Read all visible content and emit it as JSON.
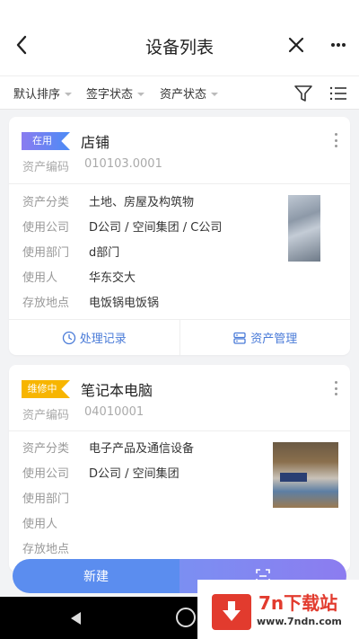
{
  "header": {
    "title": "设备列表"
  },
  "filters": [
    "默认排序",
    "签字状态",
    "资产状态"
  ],
  "labels": {
    "asset_code": "资产编码",
    "category": "资产分类",
    "company": "使用公司",
    "department": "使用部门",
    "user": "使用人",
    "location": "存放地点"
  },
  "cards": [
    {
      "badge": "在用",
      "name": "店铺",
      "asset_code": "010103.0001",
      "category": "土地、房屋及构筑物",
      "company": "D公司 / 空间集团 / C公司",
      "department": "d部门",
      "user": "华东交大",
      "location": "电饭锅电饭锅"
    },
    {
      "badge": "维修中",
      "name": "笔记本电脑",
      "asset_code": "04010001",
      "category": "电子产品及通信设备",
      "company": "D公司 / 空间集团",
      "department": "",
      "user": "",
      "location": ""
    }
  ],
  "actions": {
    "records": "处理记录",
    "manage": "资产管理"
  },
  "bottom": {
    "new_label": "新建"
  },
  "watermark": {
    "title": "7n下载站",
    "url": "www.7ndn.com"
  },
  "colors": {
    "accent": "#4a7bd8",
    "badge_repair": "#f7b500",
    "watermark_red": "#e23b2e"
  }
}
